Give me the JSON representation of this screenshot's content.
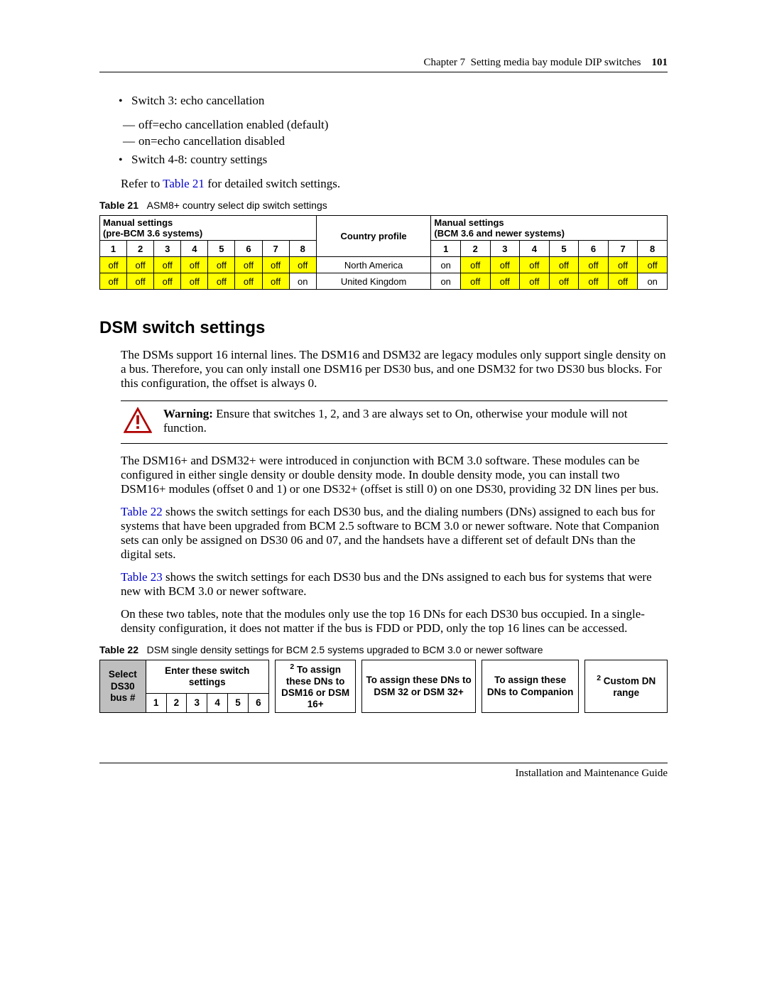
{
  "header": {
    "chapter": "Chapter 7",
    "title": "Setting media bay module DIP switches",
    "page": "101"
  },
  "bullets1": {
    "item1": "Switch 3: echo cancellation",
    "sub1": "off=echo cancellation enabled (default)",
    "sub2": "on=echo cancellation disabled",
    "item2": "Switch 4-8: country settings"
  },
  "refer": {
    "pre": "Refer to ",
    "link": "Table 21",
    "post": " for detailed switch settings."
  },
  "table21": {
    "label": "Table 21",
    "caption": "ASM8+ country select dip switch settings",
    "header_left": "Manual settings",
    "header_left_sub": "(pre-BCM 3.6 systems)",
    "header_center": "Country profile",
    "header_right": "Manual settings",
    "header_right_sub": "(BCM 3.6 and newer systems)",
    "cols": [
      "1",
      "2",
      "3",
      "4",
      "5",
      "6",
      "7",
      "8"
    ],
    "rows": [
      {
        "left": [
          "off",
          "off",
          "off",
          "off",
          "off",
          "off",
          "off",
          "off"
        ],
        "country": "North America",
        "right": [
          "on",
          "off",
          "off",
          "off",
          "off",
          "off",
          "off",
          "off"
        ],
        "left_hl": [
          true,
          true,
          true,
          true,
          true,
          true,
          true,
          true
        ],
        "right_hl": [
          false,
          true,
          true,
          true,
          true,
          true,
          true,
          true
        ]
      },
      {
        "left": [
          "off",
          "off",
          "off",
          "off",
          "off",
          "off",
          "off",
          "on"
        ],
        "country": "United Kingdom",
        "right": [
          "on",
          "off",
          "off",
          "off",
          "off",
          "off",
          "off",
          "on"
        ],
        "left_hl": [
          true,
          true,
          true,
          true,
          true,
          true,
          true,
          false
        ],
        "right_hl": [
          false,
          true,
          true,
          true,
          true,
          true,
          true,
          false
        ]
      }
    ]
  },
  "section_heading": "DSM switch settings",
  "para1": "The DSMs support 16 internal lines. The DSM16 and DSM32 are legacy modules only support single density on a bus. Therefore, you can only install one DSM16 per DS30 bus, and one DSM32 for two DS30 bus blocks. For this configuration, the offset is always 0.",
  "warning": {
    "label": "Warning:",
    "text": " Ensure that switches 1, 2, and 3 are always set to On, otherwise your module will not function."
  },
  "para2": "The DSM16+ and DSM32+ were introduced in conjunction with BCM 3.0 software. These modules can be configured in either single density or double density mode. In double density mode, you can install two DSM16+ modules (offset 0 and 1) or one DS32+ (offset is still 0) on one DS30, providing 32 DN lines per bus.",
  "para3": {
    "link": "Table 22",
    "text": " shows the switch settings for each DS30 bus, and the dialing numbers (DNs) assigned to each bus for systems that have been upgraded from BCM 2.5 software to BCM 3.0 or newer software. Note that Companion sets can only be assigned on DS30 06 and 07, and the handsets have a different set of default DNs than the digital sets."
  },
  "para4": {
    "link": "Table 23",
    "text": " shows the switch settings for each DS30 bus and the DNs assigned to each bus for systems that were new with BCM 3.0 or newer software."
  },
  "para5": "On these two tables, note that the modules only use the top 16 DNs for each DS30 bus occupied. In a single-density configuration, it does not matter if the bus is FDD or PDD, only the top 16 lines can be accessed.",
  "table22": {
    "label": "Table 22",
    "caption": "DSM single density settings for BCM 2.5 systems upgraded to BCM 3.0 or newer software",
    "col_select": "Select DS30 bus #",
    "col_enter": "Enter these switch settings",
    "col_enter_nums": [
      "1",
      "2",
      "3",
      "4",
      "5",
      "6"
    ],
    "col_assign1": "² To assign these DNs to DSM16 or DSM 16+",
    "col_assign2_line1": "To assign these DNs to",
    "col_assign2_line2": " DSM 32 or DSM 32+",
    "col_assign3_line1": "To assign these DNs to",
    "col_assign3_line2": " Companion",
    "col_custom": "² Custom DN range"
  },
  "footer": "Installation and Maintenance Guide"
}
